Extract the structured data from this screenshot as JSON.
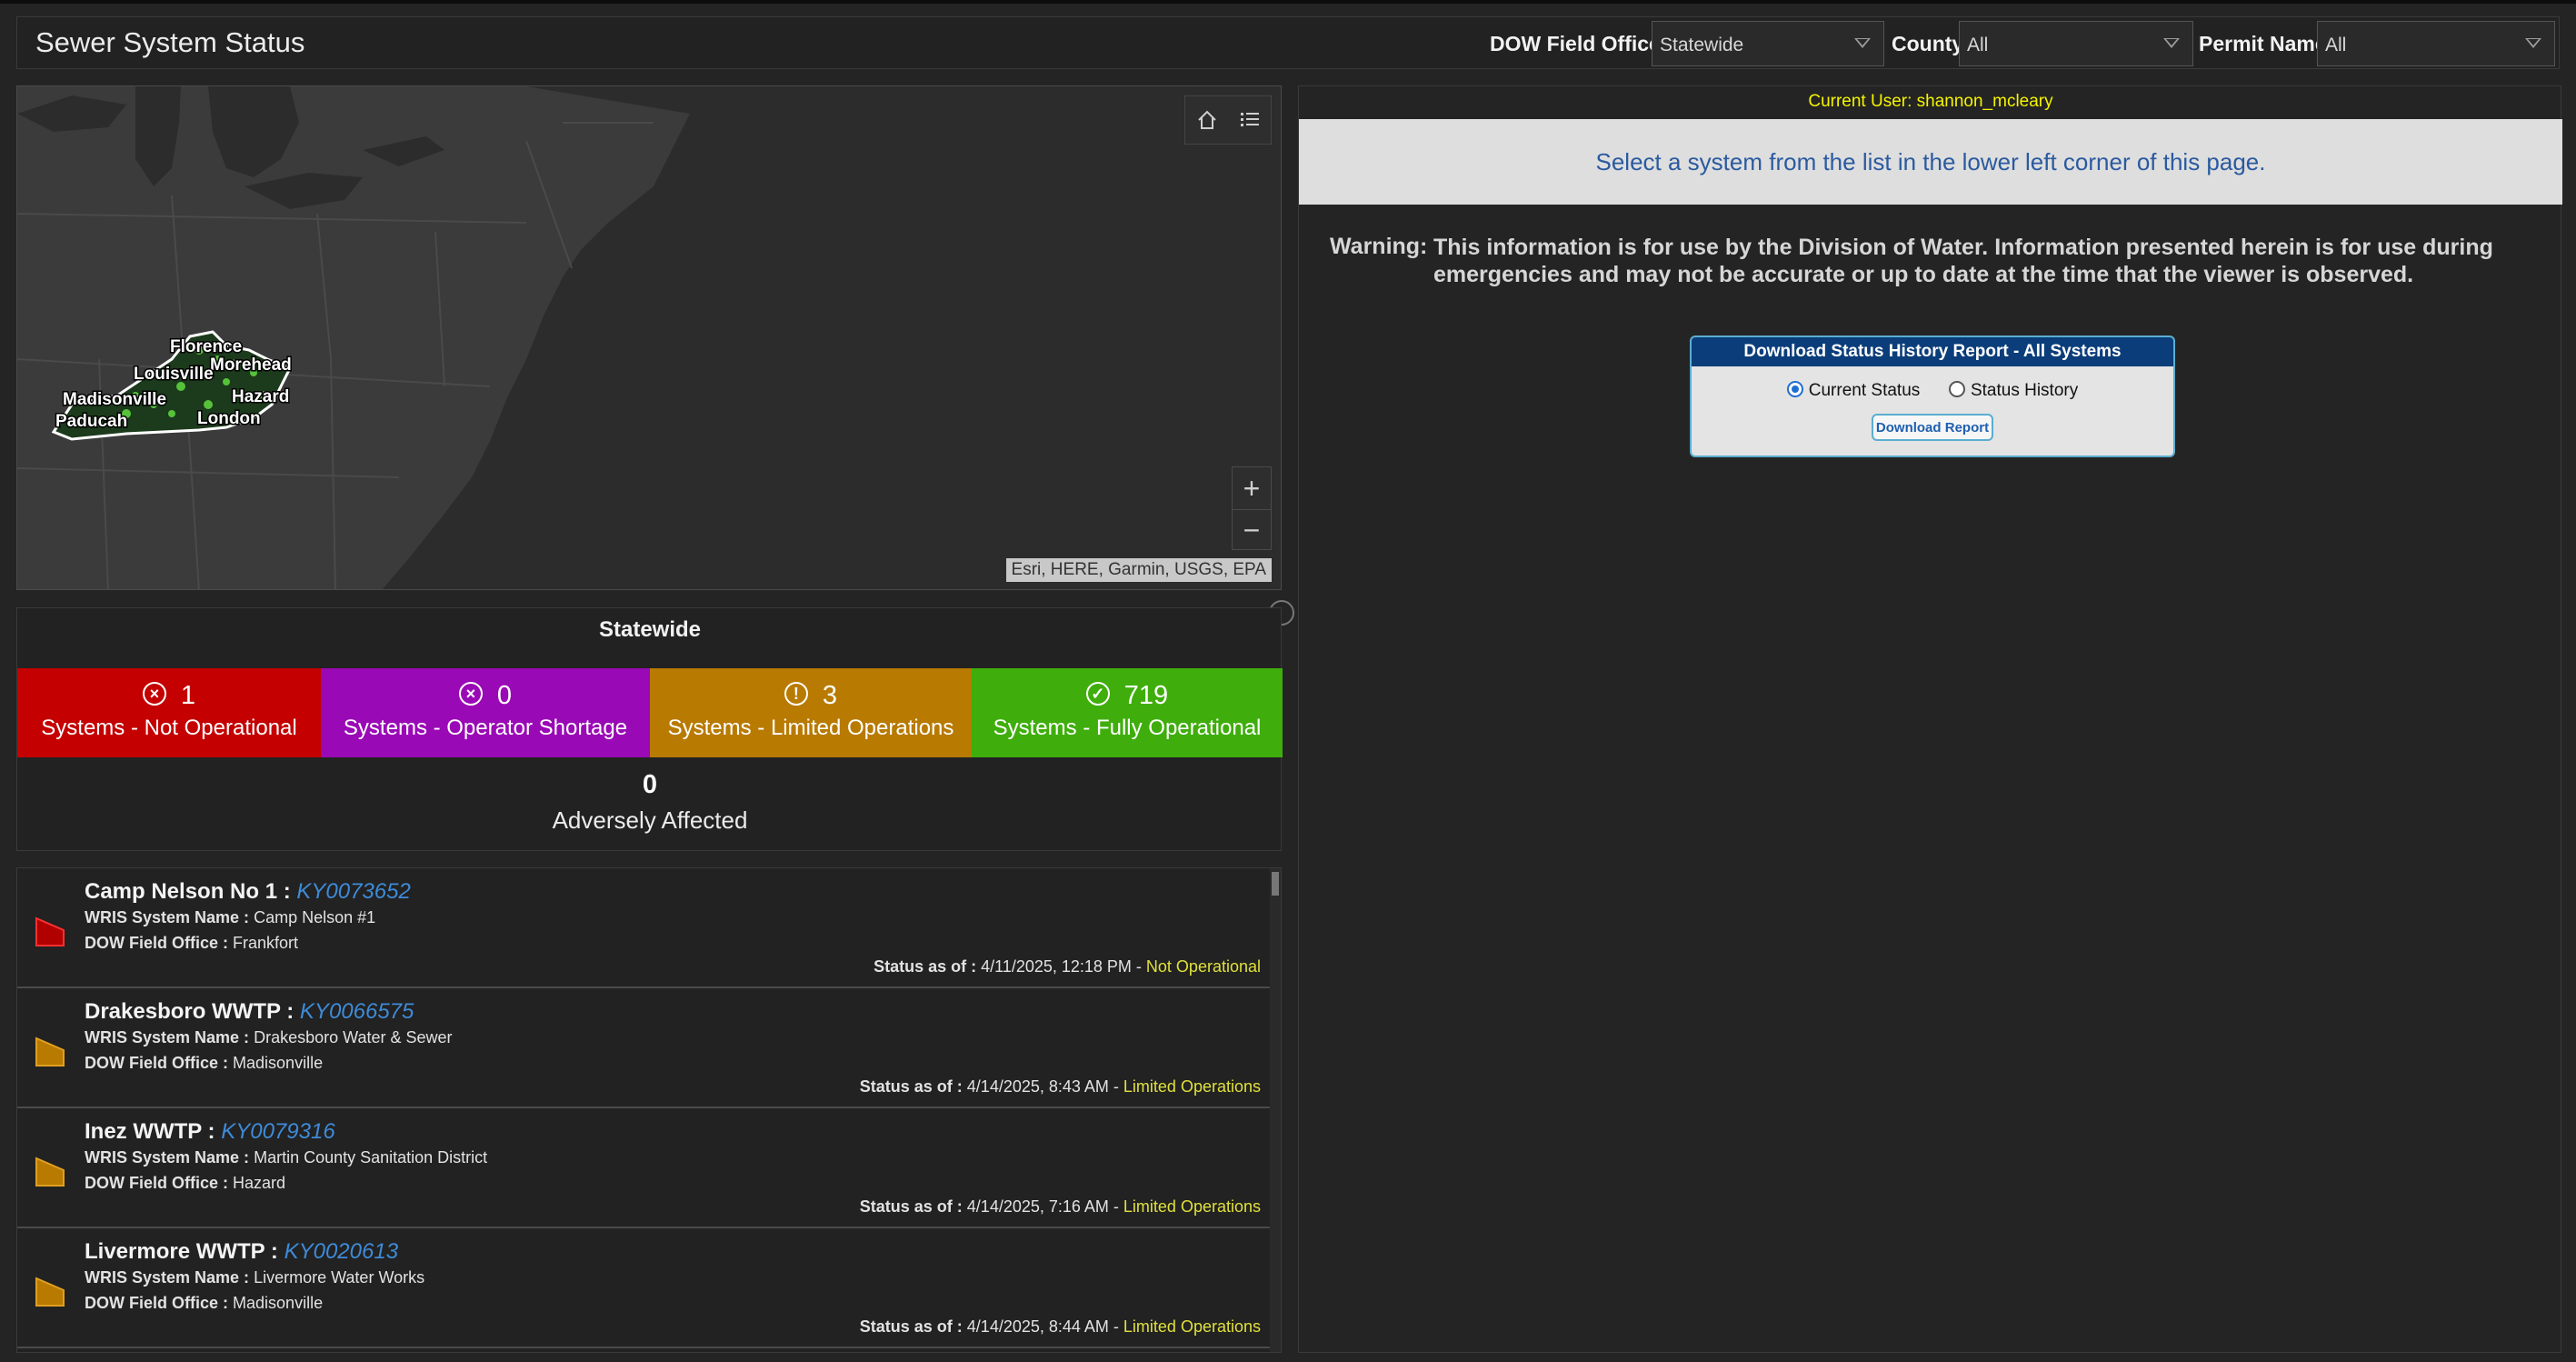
{
  "header": {
    "title": "Sewer System Status",
    "filters": [
      {
        "label": "DOW Field Office",
        "value": "Statewide"
      },
      {
        "label": "County",
        "value": "All"
      },
      {
        "label": "Permit Name",
        "value": "All"
      }
    ]
  },
  "map": {
    "labels": [
      "Florence",
      "Morehead",
      "Louisville",
      "Hazard",
      "Madisonville",
      "London",
      "Paducah"
    ],
    "attribution": "Esri, HERE, Garmin, USGS, EPA",
    "zoom_in": "+",
    "zoom_out": "−"
  },
  "stats": {
    "title": "Statewide",
    "tiles": [
      {
        "count": "1",
        "label": "Systems - Not Operational",
        "color": "#c40000",
        "icon": "x-circle-icon"
      },
      {
        "count": "0",
        "label": "Systems - Operator Shortage",
        "color": "#9a09b6",
        "icon": "x-circle-icon"
      },
      {
        "count": "3",
        "label": "Systems - Limited Operations",
        "color": "#b87a00",
        "icon": "alert-circle-icon"
      },
      {
        "count": "719",
        "label": "Systems - Fully Operational",
        "color": "#3fae0c",
        "icon": "check-circle-icon"
      }
    ],
    "adverse_count": "0",
    "adverse_label": "Adversely Affected"
  },
  "systems": [
    {
      "name": "Camp Nelson No 1",
      "permit": "KY0073652",
      "wris_label": "WRIS System Name :",
      "wris": "Camp Nelson #1",
      "office_label": "DOW Field Office :",
      "office": "Frankfort",
      "status_label": "Status as of :",
      "status_time": "4/11/2025, 12:18 PM",
      "status": "Not Operational",
      "flag_color": "#b00000"
    },
    {
      "name": "Drakesboro WWTP",
      "permit": "KY0066575",
      "wris_label": "WRIS System Name :",
      "wris": "Drakesboro Water & Sewer",
      "office_label": "DOW Field Office :",
      "office": "Madisonville",
      "status_label": "Status as of :",
      "status_time": "4/14/2025, 8:43 AM",
      "status": "Limited Operations",
      "flag_color": "#b87a00"
    },
    {
      "name": "Inez WWTP",
      "permit": "KY0079316",
      "wris_label": "WRIS System Name :",
      "wris": "Martin County Sanitation District",
      "office_label": "DOW Field Office :",
      "office": "Hazard",
      "status_label": "Status as of :",
      "status_time": "4/14/2025, 7:16 AM",
      "status": "Limited Operations",
      "flag_color": "#b87a00"
    },
    {
      "name": "Livermore WWTP",
      "permit": "KY0020613",
      "wris_label": "WRIS System Name :",
      "wris": "Livermore Water Works",
      "office_label": "DOW Field Office :",
      "office": "Madisonville",
      "status_label": "Status as of :",
      "status_time": "4/14/2025, 8:44 AM",
      "status": "Limited Operations",
      "flag_color": "#b87a00"
    }
  ],
  "right": {
    "current_user": "Current User: shannon_mcleary",
    "banner": "Select a system from the list in the lower left corner of this page.",
    "warning_label": "Warning:",
    "warning_text": "This information is for use by the Division of Water. Information presented herein is for use during emergencies and may not be accurate or up to date at the time that the viewer is observed.",
    "report": {
      "title": "Download Status History Report - All Systems",
      "option_current": "Current Status",
      "option_history": "Status History",
      "selected": "Current Status",
      "button": "Download Report"
    }
  },
  "colors": {
    "status_text": "#e0e03c",
    "permit_link": "#3e8bd8",
    "user_text": "#f4f400"
  }
}
